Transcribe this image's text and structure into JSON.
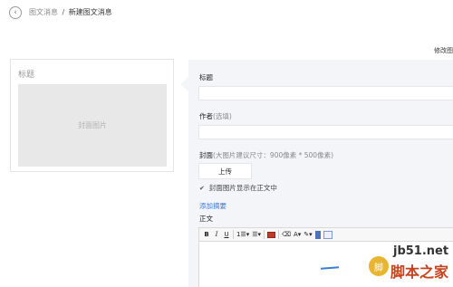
{
  "header": {
    "back_icon": "chevron-left-circle-icon",
    "breadcrumb_link": "图文消息",
    "breadcrumb_separator": "/",
    "breadcrumb_current": "新建图文消息"
  },
  "preview_toggle": "修改图",
  "thumbnail": {
    "title": "标题",
    "cover_placeholder": "封面图片"
  },
  "form": {
    "title_label": "标题",
    "title_value": "",
    "author_label": "作者",
    "author_hint": "(选填)",
    "author_value": "",
    "cover_label": "封面",
    "cover_hint": "(大图片建议尺寸：900像素 * 500像素)",
    "upload_label": "上传",
    "show_cover_label": "封面图片显示在正文中",
    "show_cover_checked": true,
    "add_abstract_link": "添加摘要",
    "body_label": "正文"
  },
  "toolbar": {
    "bold": "B",
    "italic": "I",
    "underline": "U",
    "ordered_list": "1☰▾",
    "bullet_list": "☰▾",
    "font_color": "A▾",
    "highlight": "✎▾",
    "icons": [
      "bold-icon",
      "italic-icon",
      "underline-icon",
      "ordered-list-icon",
      "bullet-list-icon",
      "media-icon",
      "eraser-icon",
      "font-color-icon",
      "background-color-icon",
      "insert-file-icon",
      "insert-image-icon"
    ]
  },
  "watermark": {
    "domain": "jb51.net",
    "logo": "脚",
    "text": "脚本之家"
  }
}
